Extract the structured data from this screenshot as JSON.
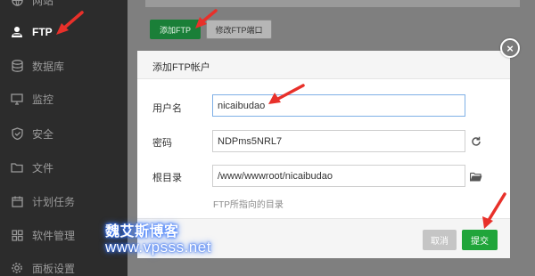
{
  "sidebar": {
    "items": [
      {
        "label": "网站",
        "icon": "globe-icon",
        "active": false
      },
      {
        "label": "FTP",
        "icon": "ftp-user-icon",
        "active": true
      },
      {
        "label": "数据库",
        "icon": "database-icon",
        "active": false
      },
      {
        "label": "监控",
        "icon": "monitor-icon",
        "active": false
      },
      {
        "label": "安全",
        "icon": "shield-icon",
        "active": false
      },
      {
        "label": "文件",
        "icon": "folder-icon",
        "active": false
      },
      {
        "label": "计划任务",
        "icon": "calendar-icon",
        "active": false
      },
      {
        "label": "软件管理",
        "icon": "grid-icon",
        "active": false
      },
      {
        "label": "面板设置",
        "icon": "gear-icon",
        "active": false
      }
    ]
  },
  "toolbar": {
    "add_ftp_label": "添加FTP",
    "modify_port_label": "修改FTP端口"
  },
  "modal": {
    "title": "添加FTP帐户",
    "username_label": "用户名",
    "username_value": "nicaibudao",
    "password_label": "密码",
    "password_value": "NDPms5NRL7",
    "root_label": "根目录",
    "root_value": "/www/wwwroot/nicaibudao",
    "root_hint": "FTP所指向的目录",
    "cancel_label": "取消",
    "submit_label": "提交",
    "close_symbol": "×"
  },
  "watermark": {
    "name": "魏艾斯博客",
    "url": "www.vpsss.net"
  },
  "colors": {
    "sidebar_bg": "#2c2c2c",
    "primary_green": "#20a53a",
    "annotation_red": "#e8302a"
  }
}
